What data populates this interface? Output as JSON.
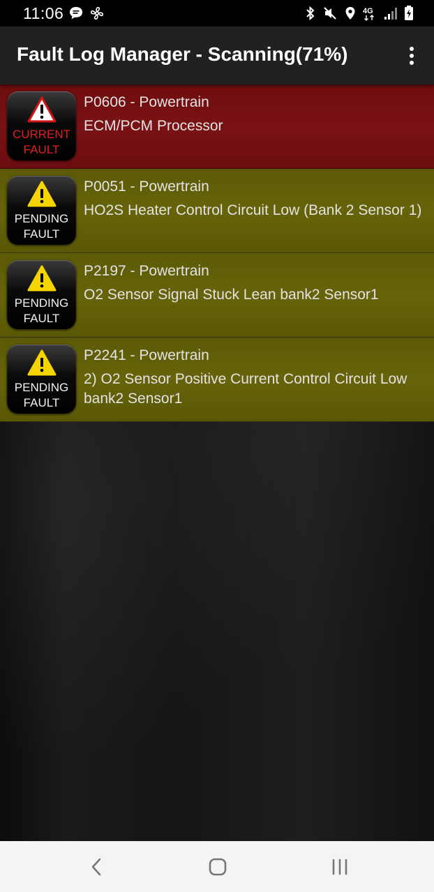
{
  "status_bar": {
    "time": "11:06",
    "left_icons": [
      "message-icon",
      "fan-icon"
    ],
    "right_icons": [
      "bluetooth-icon",
      "mute-icon",
      "location-icon",
      "lte-icon",
      "signal-icon",
      "battery-icon"
    ],
    "network_label": "4G"
  },
  "app_bar": {
    "title": "Fault Log Manager - Scanning(71%)",
    "menu_icon": "overflow-menu-icon"
  },
  "faults": [
    {
      "status": "current",
      "badge_line1": "CURRENT",
      "badge_line2": "FAULT",
      "code": "P0606 - Powertrain",
      "description": "ECM/PCM Processor",
      "color": "#7a1214"
    },
    {
      "status": "pending",
      "badge_line1": "PENDING",
      "badge_line2": "FAULT",
      "code": "P0051 - Powertrain",
      "description": "HO2S Heater Control Circuit Low (Bank 2 Sensor 1)",
      "color": "#66630a"
    },
    {
      "status": "pending",
      "badge_line1": "PENDING",
      "badge_line2": "FAULT",
      "code": "P2197 - Powertrain",
      "description": "O2 Sensor Signal Stuck Lean bank2 Sensor1",
      "color": "#66630a"
    },
    {
      "status": "pending",
      "badge_line1": "PENDING",
      "badge_line2": "FAULT",
      "code": "P2241 - Powertrain",
      "description": "2) O2 Sensor Positive Current Control Circuit Low bank2 Sensor1",
      "color": "#66630a"
    }
  ],
  "nav_bar": {
    "buttons": [
      "back-icon",
      "home-icon",
      "recent-apps-icon"
    ]
  }
}
